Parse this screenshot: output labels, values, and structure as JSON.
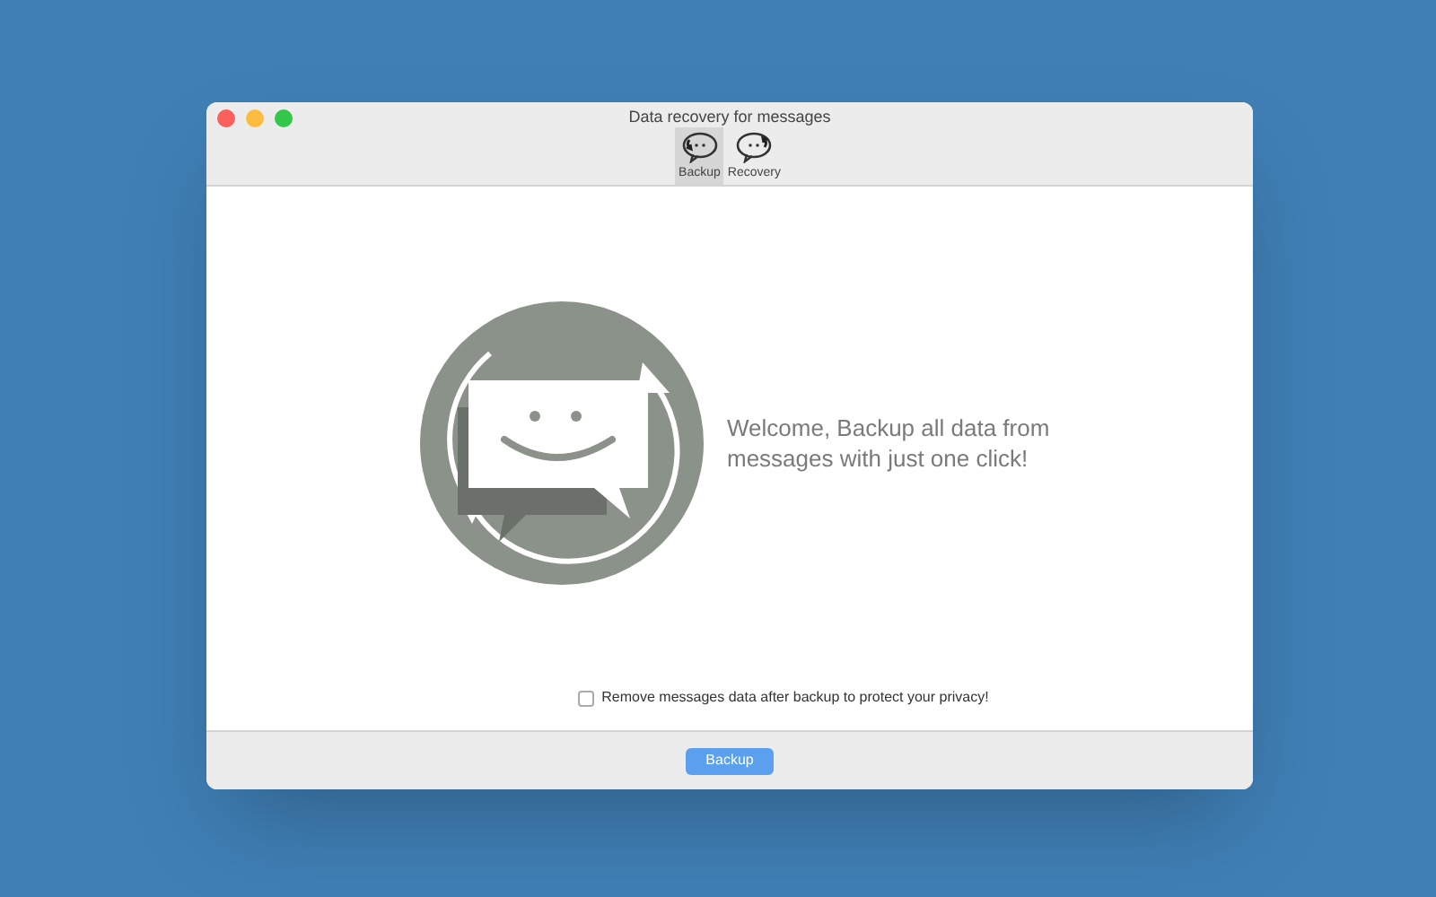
{
  "window": {
    "title": "Data recovery for messages"
  },
  "toolbar": [
    {
      "label": "Backup",
      "kind": "backup",
      "selected": true
    },
    {
      "label": "Recovery",
      "kind": "recovery",
      "selected": false
    }
  ],
  "welcome": {
    "message": "Welcome, Backup all data from messages with just one click!"
  },
  "option": {
    "label": "Remove messages data after backup to protect your privacy!",
    "checked": false
  },
  "footer": {
    "button": "Backup"
  }
}
